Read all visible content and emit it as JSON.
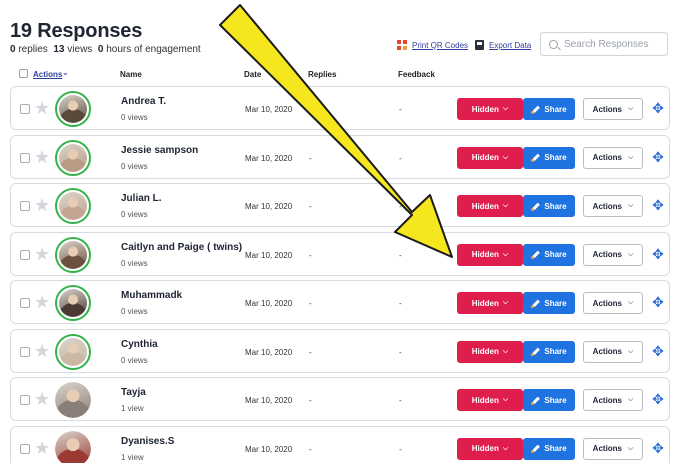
{
  "header": {
    "title": "19 Responses",
    "replies_count": "0",
    "replies_label": "replies",
    "views_count": "13",
    "views_label": "views",
    "hours_count": "0",
    "hours_label": "hours of engagement"
  },
  "toolbar": {
    "print_qr_label": "Print QR Codes",
    "export_label": "Export Data",
    "search_placeholder": "Search Responses"
  },
  "columns": {
    "actions": "Actions",
    "name": "Name",
    "date": "Date",
    "replies": "Replies",
    "feedback": "Feedback"
  },
  "buttons": {
    "hidden": "Hidden",
    "share": "Share",
    "actions": "Actions"
  },
  "colors": {
    "hidden_button": "#e01e4e",
    "share_button": "#1f73e0",
    "avatar_ring": "#34b34a",
    "annotation_arrow": "#f5e61d"
  },
  "rows": [
    {
      "name": "Andrea T.",
      "views": "0 views",
      "date": "Mar 10, 2020",
      "replies": "",
      "feedback": "-",
      "ring": true,
      "avatar_color": "#5a4a3c"
    },
    {
      "name": "Jessie sampson",
      "views": "0 views",
      "date": "Mar 10, 2020",
      "replies": "-",
      "feedback": "-",
      "ring": true,
      "avatar_color": "#b79c83"
    },
    {
      "name": "Julian L.",
      "views": "0 views",
      "date": "Mar 10, 2020",
      "replies": "-",
      "feedback": "-",
      "ring": true,
      "avatar_color": "#c2a490"
    },
    {
      "name": "Caitlyn and Paige ( twins)",
      "views": "0 views",
      "date": "Mar 10, 2020",
      "replies": "-",
      "feedback": "-",
      "ring": true,
      "avatar_color": "#6b5040"
    },
    {
      "name": "Muhammadk",
      "views": "0 views",
      "date": "Mar 10, 2020",
      "replies": "-",
      "feedback": "-",
      "ring": true,
      "avatar_color": "#4a3a33"
    },
    {
      "name": "Cynthia",
      "views": "0 views",
      "date": "Mar 10, 2020",
      "replies": "-",
      "feedback": "-",
      "ring": true,
      "avatar_color": "#c9b8a4"
    },
    {
      "name": "Tayja",
      "views": "1 view",
      "date": "Mar 10, 2020",
      "replies": "-",
      "feedback": "-",
      "ring": false,
      "avatar_color": "#8a7f78"
    },
    {
      "name": "Dyanises.S",
      "views": "1 view",
      "date": "Mar 10, 2020",
      "replies": "-",
      "feedback": "-",
      "ring": false,
      "avatar_color": "#9a3a32"
    }
  ]
}
